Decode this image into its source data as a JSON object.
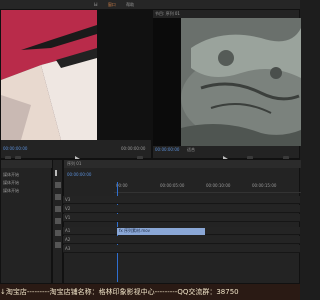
{
  "menu": {
    "items": [
      "Ы",
      "窗口",
      "帮助"
    ]
  },
  "source_monitor": {
    "timecode": "00:00:00:00",
    "time_right": "00:00:00:00"
  },
  "program_monitor": {
    "title": "节目: 序列 01",
    "timecode": "00:00:00:00",
    "fit_label": "适合"
  },
  "project_panel": {
    "rows": [
      "媒体开始",
      "媒体开始",
      "媒体开始"
    ]
  },
  "timeline": {
    "tab": "序列 01",
    "timecode": "00:00:00:00",
    "ruler": [
      "00:00",
      "00:00:05:00",
      "00:00:10:00",
      "00:00:15:00"
    ],
    "tracks": [
      {
        "name": "V3"
      },
      {
        "name": "V2"
      },
      {
        "name": "V1"
      },
      {
        "name": "A1"
      },
      {
        "name": "A2"
      },
      {
        "name": "A3"
      }
    ],
    "clip_label": "fx 序列素材.mov"
  },
  "watermark": {
    "text": "↓淘宝店---------淘宝店铺名称：格林印象影视中心---------QQ交流群：38750"
  },
  "colors": {
    "bg": "#1d1d1d",
    "clip": "#8aa7d6",
    "timecode_blue": "#5a8fd8",
    "watermark_text": "#f0e4c8"
  }
}
